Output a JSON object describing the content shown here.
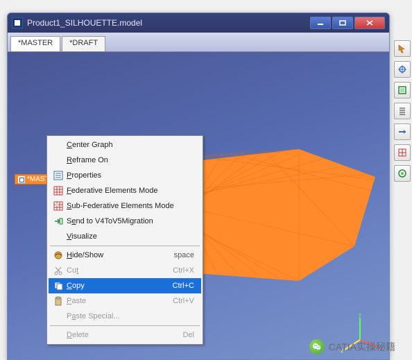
{
  "window": {
    "title": "Product1_SILHOUETTE.model",
    "tabs": [
      {
        "label": "*MASTER"
      },
      {
        "label": "*DRAFT"
      }
    ]
  },
  "workspace": {
    "tag_label": "*MASTER"
  },
  "context_menu": {
    "items": [
      {
        "label": "Center Graph",
        "underline": "C",
        "icon": "",
        "shortcut": "",
        "state": "normal"
      },
      {
        "label": "Reframe On",
        "underline": "R",
        "icon": "",
        "shortcut": "",
        "state": "normal"
      },
      {
        "label": "Properties",
        "underline": "P",
        "icon": "properties-icon",
        "shortcut": "",
        "state": "normal"
      },
      {
        "label": "Federative Elements Mode",
        "underline": "F",
        "icon": "grid-icon",
        "shortcut": "",
        "state": "normal"
      },
      {
        "label": "Sub-Federative Elements Mode",
        "underline": "S",
        "icon": "subgrid-icon",
        "shortcut": "",
        "state": "normal"
      },
      {
        "label": "Send to V4ToV5Migration",
        "underline": "e",
        "icon": "send-icon",
        "shortcut": "",
        "state": "normal"
      },
      {
        "label": "Visualize",
        "underline": "V",
        "icon": "",
        "shortcut": "",
        "state": "normal"
      },
      {
        "sep": true
      },
      {
        "label": "Hide/Show",
        "underline": "H",
        "icon": "hideshow-icon",
        "shortcut": "space",
        "state": "normal"
      },
      {
        "label": "Cut",
        "underline": "t",
        "icon": "cut-icon",
        "shortcut": "Ctrl+X",
        "state": "disabled"
      },
      {
        "label": "Copy",
        "underline": "C",
        "icon": "copy-icon",
        "shortcut": "Ctrl+C",
        "state": "selected"
      },
      {
        "label": "Paste",
        "underline": "P",
        "icon": "paste-icon",
        "shortcut": "Ctrl+V",
        "state": "disabled"
      },
      {
        "label": "Paste Special...",
        "underline": "a",
        "icon": "",
        "shortcut": "",
        "state": "disabled"
      },
      {
        "sep": true
      },
      {
        "label": "Delete",
        "underline": "D",
        "icon": "",
        "shortcut": "Del",
        "state": "disabled"
      }
    ]
  },
  "toolbar": {
    "buttons": [
      "pointer-icon",
      "pan-icon",
      "rotate-icon",
      "zoom-icon",
      "fit-icon",
      "grid-icon",
      "flyto-icon"
    ]
  },
  "watermark": {
    "text": "CATIA实操秘籍"
  },
  "colors": {
    "mesh": "#ff8a2b",
    "bg_top": "#4a5694",
    "bg_bottom": "#7a94c9",
    "highlight": "#1b6fd8"
  }
}
